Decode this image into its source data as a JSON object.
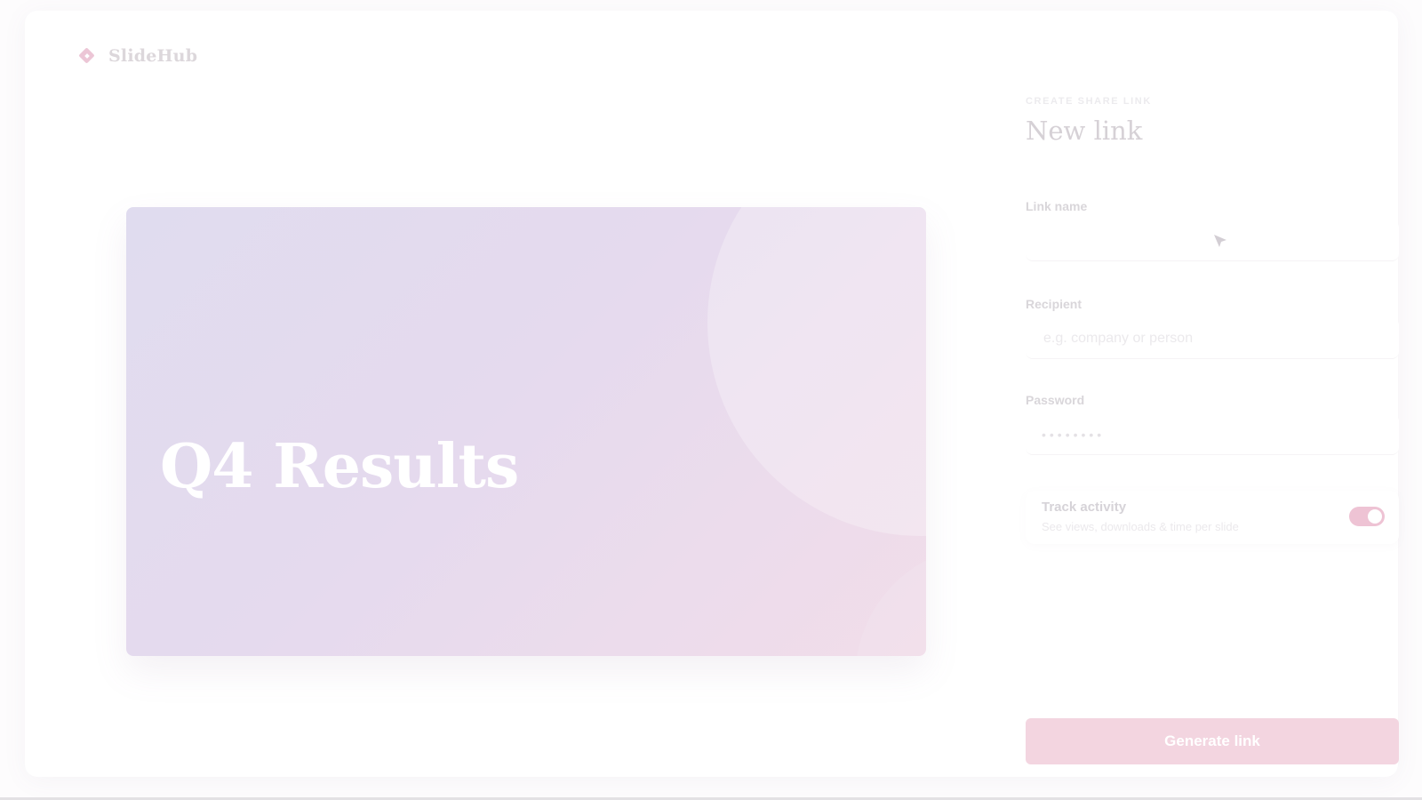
{
  "app": {
    "name": "SlideHub",
    "logo_icon": "diamond-logo-icon",
    "accent": "#eec3d4"
  },
  "slide": {
    "title": "Q4 Results",
    "gradient": [
      "#e0dcef",
      "#f1dde9"
    ]
  },
  "panel": {
    "overline": "CREATE SHARE LINK",
    "title": "New link",
    "fields": {
      "link_name": {
        "label": "Link name",
        "value": "",
        "placeholder": ""
      },
      "recipient": {
        "label": "Recipient",
        "value": "",
        "placeholder": "e.g. company or person"
      },
      "password": {
        "label": "Password",
        "value": "••••••••"
      }
    },
    "track_activity": {
      "title": "Track activity",
      "description": "See views, downloads & time per slide",
      "enabled": true
    },
    "generate_label": "Generate link"
  }
}
